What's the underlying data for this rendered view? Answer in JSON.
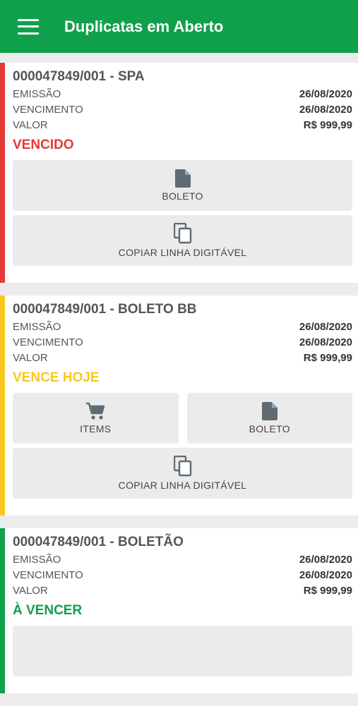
{
  "appbar": {
    "title": "Duplicatas em Aberto",
    "menu_icon": "hamburger-menu-icon",
    "color": "#10a04b"
  },
  "cards": [
    {
      "title": "000047849/001 - SPA",
      "emissao_label": "EMISSÃO",
      "emissao": "26/08/2020",
      "vencimento_label": "VENCIMENTO",
      "vencimento": "26/08/2020",
      "valor_label": "VALOR",
      "valor": "R$ 999,99",
      "status": "VENCIDO",
      "status_color": "#e53935",
      "boleto_label": "BOLETO",
      "copiar_label": "COPIAR LINHA DIGITÁVEL"
    },
    {
      "title": "000047849/001 - BOLETO BB",
      "emissao_label": "EMISSÃO",
      "emissao": "26/08/2020",
      "vencimento_label": "VENCIMENTO",
      "vencimento": "26/08/2020",
      "valor_label": "VALOR",
      "valor": "R$ 999,99",
      "status": "VENCE HOJE",
      "status_color": "#f9c81e",
      "items_label": "ITEMS",
      "boleto_label": "BOLETO",
      "copiar_label": "COPIAR LINHA DIGITÁVEL"
    },
    {
      "title": "000047849/001 - BOLETÃO",
      "emissao_label": "EMISSÃO",
      "emissao": "26/08/2020",
      "vencimento_label": "VENCIMENTO",
      "vencimento": "26/08/2020",
      "valor_label": "VALOR",
      "valor": "R$ 999,99",
      "status": "À VENCER",
      "status_color": "#10a04b"
    }
  ]
}
